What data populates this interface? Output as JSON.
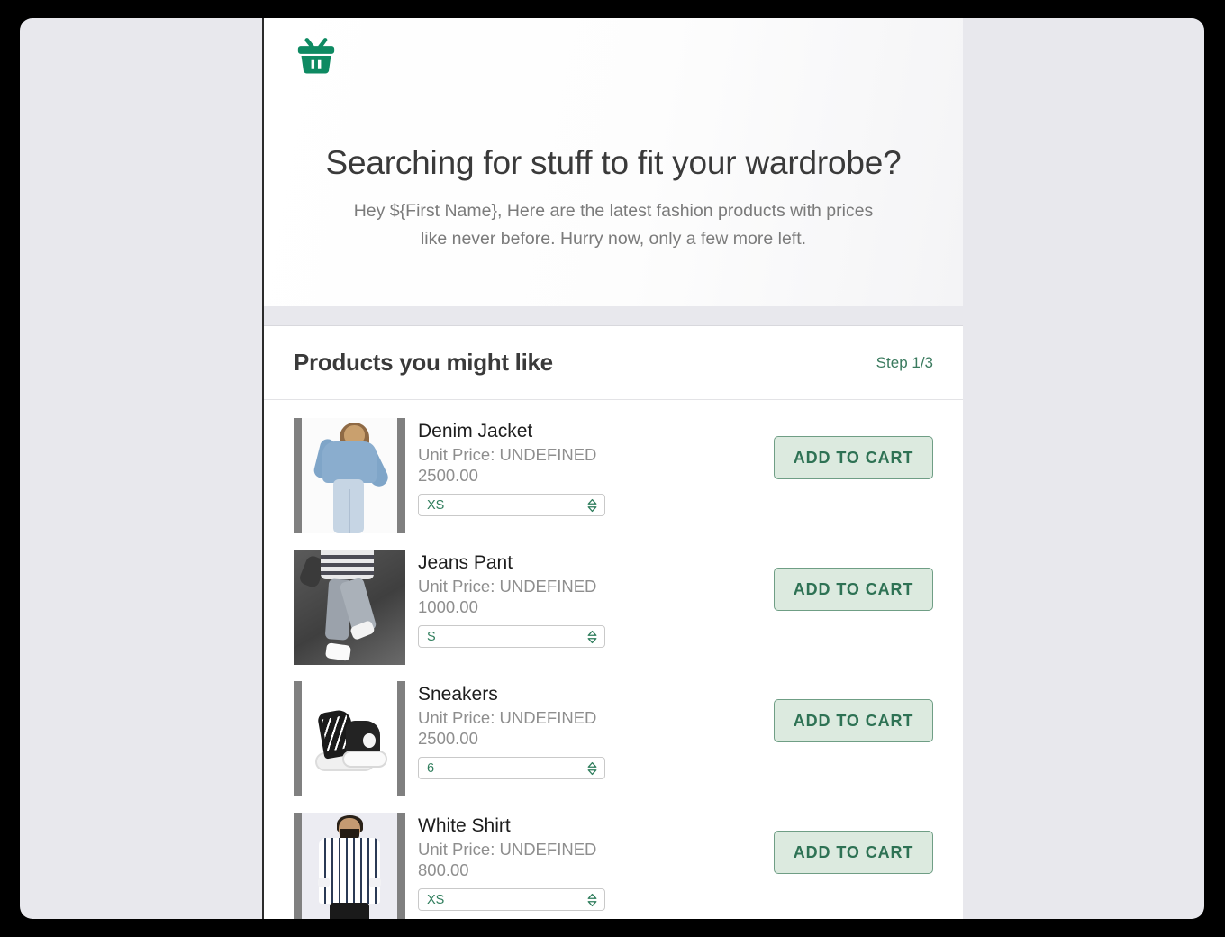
{
  "hero": {
    "logo_icon": "shopping-basket-icon",
    "brand_color": "#0e8a62",
    "title": "Searching for stuff to fit your wardrobe?",
    "subtitle": "Hey ${First Name}, Here are the latest fashion products with prices like never before. Hurry now, only a few more left."
  },
  "products_card": {
    "title": "Products you might like",
    "step_label": "Step 1/3",
    "step_color": "#3a7a5e",
    "add_to_cart_label": "ADD TO CART",
    "products": [
      {
        "name": "Denim Jacket",
        "price_line": "Unit Price: UNDEFINED 2500.00",
        "size_value": "XS",
        "image_alt": "woman wearing a light blue cropped denim jacket",
        "letterboxed": true
      },
      {
        "name": "Jeans Pant",
        "price_line": "Unit Price: UNDEFINED 1000.00",
        "size_value": "S",
        "image_alt": "man in gray jeans and white sneakers on dark background",
        "letterboxed": false
      },
      {
        "name": "Sneakers",
        "price_line": "Unit Price: UNDEFINED 2500.00",
        "size_value": "6",
        "image_alt": "pair of black and white high-top sneakers",
        "letterboxed": true
      },
      {
        "name": "White Shirt",
        "price_line": "Unit Price: UNDEFINED 800.00",
        "size_value": "XS",
        "image_alt": "man wearing a white vertically striped shirt",
        "letterboxed": true
      }
    ]
  }
}
